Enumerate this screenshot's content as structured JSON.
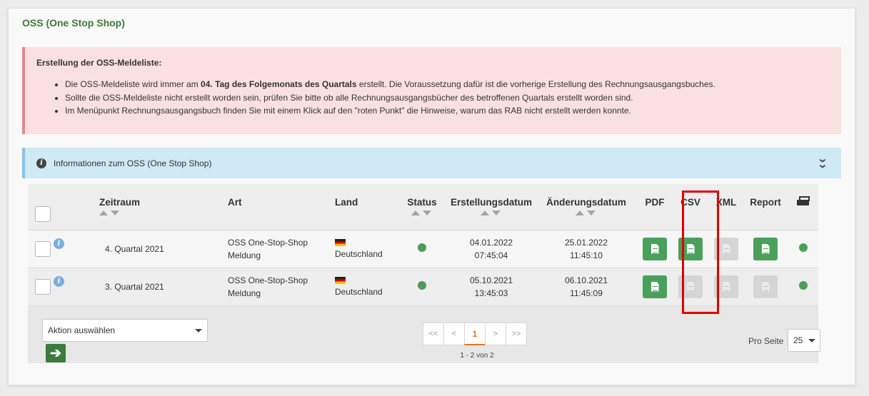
{
  "page_title": "OSS (One Stop Shop)",
  "alert": {
    "title": "Erstellung der OSS-Meldeliste:",
    "items": [
      {
        "before": "Die OSS-Meldeliste wird immer am ",
        "bold": "04. Tag des Folgemonats des Quartals",
        "after": " erstellt. Die Voraussetzung dafür ist die vorherige Erstellung des Rechnungsausgangsbuches."
      },
      {
        "text": "Sollte die OSS-Meldeliste nicht erstellt worden sein, prüfen Sie bitte ob alle Rechnungsausgangsbücher des betroffenen Quartals erstellt worden sind."
      },
      {
        "text": "Im Menüpunkt Rechnungsausgangsbuch finden Sie mit einem Klick auf den \"roten Punkt\" die Hinweise, warum das RAB nicht erstellt werden konnte."
      }
    ]
  },
  "info_bar": {
    "label": "Informationen zum OSS (One Stop Shop)"
  },
  "table": {
    "headers": {
      "zeitraum": "Zeitraum",
      "art": "Art",
      "land": "Land",
      "status": "Status",
      "erstellungsdatum": "Erstellungsdatum",
      "aenderungsdatum": "Änderungsdatum",
      "pdf": "PDF",
      "csv": "CSV",
      "xml": "XML",
      "report": "Report"
    },
    "rows": [
      {
        "zeitraum": "4. Quartal 2021",
        "art_line1": "OSS One-Stop-Shop",
        "art_line2": "Meldung",
        "land": "Deutschland",
        "erstellt_date": "04.01.2022",
        "erstellt_time": "07:45:04",
        "geaendert_date": "25.01.2022",
        "geaendert_time": "11:45:10"
      },
      {
        "zeitraum": "3. Quartal 2021",
        "art_line1": "OSS One-Stop-Shop",
        "art_line2": "Meldung",
        "land": "Deutschland",
        "erstellt_date": "05.10.2021",
        "erstellt_time": "13:45:03",
        "geaendert_date": "06.10.2021",
        "geaendert_time": "11:45:09"
      }
    ]
  },
  "action_select": {
    "value": "Aktion auswählen"
  },
  "pagination": {
    "first": "<<",
    "prev": "<",
    "current": "1",
    "next": ">",
    "last": ">>",
    "count": "1 - 2 von 2"
  },
  "per_page": {
    "label": "Pro Seite",
    "value": "25"
  },
  "colors": {
    "accent_green": "#4aa05a",
    "title_green": "#3c7a3e",
    "highlight": "#e00000",
    "pager_active": "#e07a1f"
  }
}
